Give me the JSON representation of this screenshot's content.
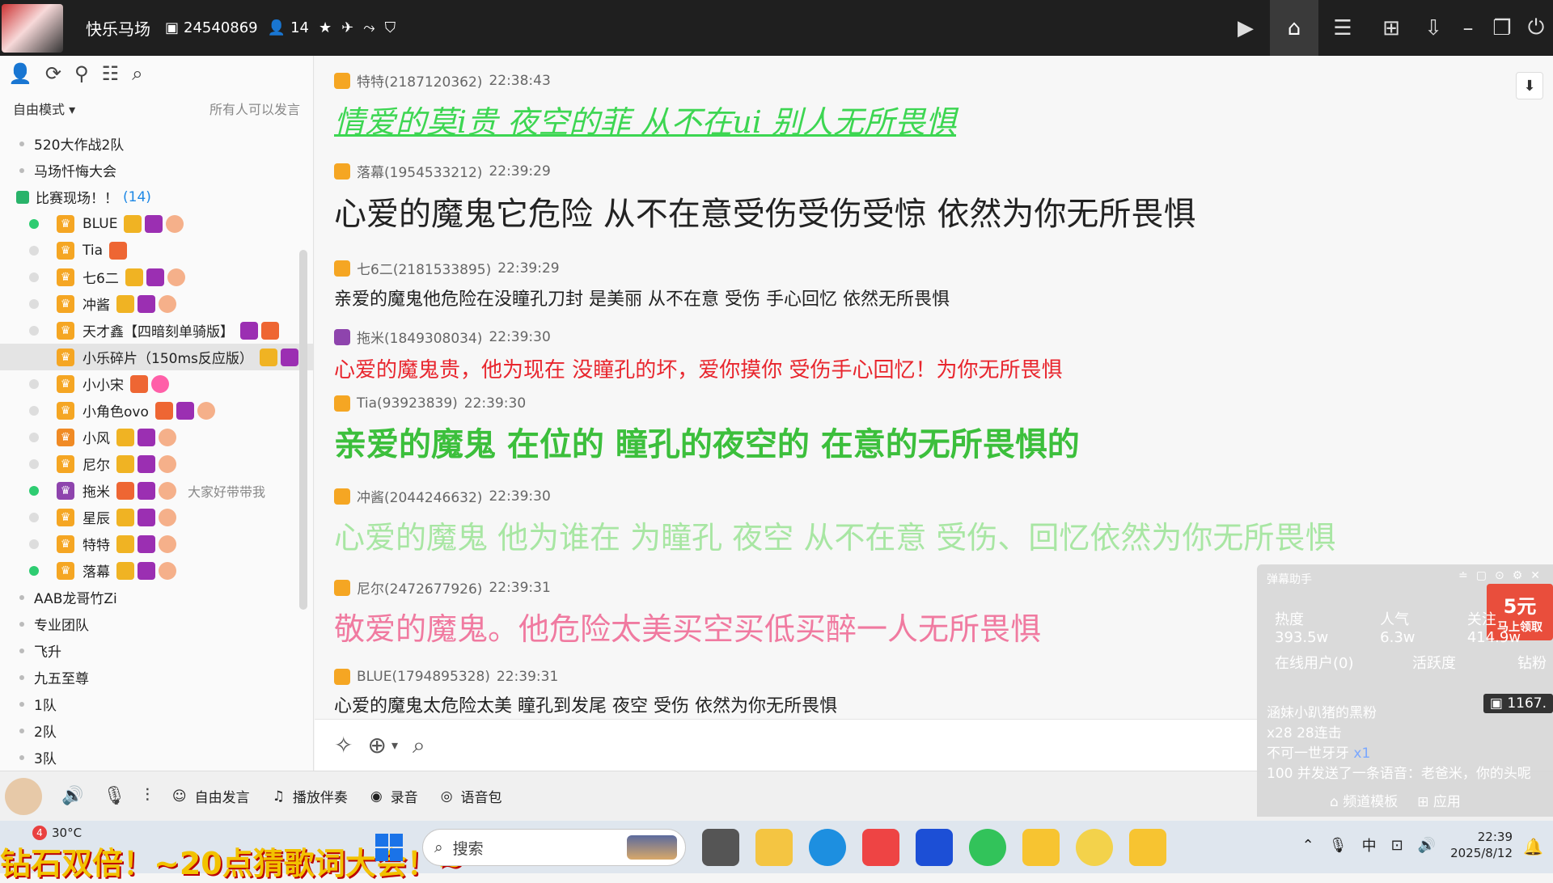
{
  "topbar": {
    "room_name": "快乐马场",
    "room_id": "24540869",
    "member_count": "14"
  },
  "sidebar": {
    "mode": "自由模式",
    "mode_note": "所有人可以发言",
    "groups_top": [
      "520大作战2队",
      "马场忏悔大会"
    ],
    "open_group": {
      "name": "比赛现场！！",
      "count": "(14)"
    },
    "members": [
      {
        "name": "BLUE",
        "online": true,
        "note": ""
      },
      {
        "name": "Tia",
        "online": false,
        "note": ""
      },
      {
        "name": "七6二",
        "online": false,
        "note": ""
      },
      {
        "name": "冲酱",
        "online": false,
        "note": ""
      },
      {
        "name": "天才鑫【四暗刻单骑版】",
        "online": false,
        "note": ""
      },
      {
        "name": "小乐碎片（150ms反应版）",
        "online": false,
        "note": "",
        "selected": true
      },
      {
        "name": "小小宋",
        "online": false,
        "note": ""
      },
      {
        "name": "小角色ovo",
        "online": false,
        "note": ""
      },
      {
        "name": "小风",
        "online": false,
        "note": ""
      },
      {
        "name": "尼尔",
        "online": false,
        "note": ""
      },
      {
        "name": "拖米",
        "online": true,
        "note": "大家好带带我"
      },
      {
        "name": "星辰",
        "online": false,
        "note": ""
      },
      {
        "name": "特特",
        "online": false,
        "note": ""
      },
      {
        "name": "落幕",
        "online": true,
        "note": ""
      }
    ],
    "groups_bottom": [
      "AAB龙哥竹Zi",
      "专业团队",
      "飞升",
      "九五至尊",
      "1队",
      "2队",
      "3队"
    ]
  },
  "chat": {
    "messages": [
      {
        "user": "特特(2187120362)",
        "time": "22:38:43",
        "text": "情爱的莫i贵   夜空的菲   从不在ui   别人无所畏惧",
        "color": "#3dd652",
        "size": 38,
        "italic": true,
        "underline": true
      },
      {
        "user": "落幕(1954533212)",
        "time": "22:39:29",
        "text": "心爱的魔鬼它危险  从不在意受伤受伤受惊  依然为你无所畏惧",
        "color": "#222222",
        "size": 40
      },
      {
        "user": "七6二(2181533895)",
        "time": "22:39:29",
        "text": "亲爱的魔鬼他危险在没瞳孔刀封  是美丽  从不在意  受伤  手心回忆  依然无所畏惧",
        "color": "#222222",
        "size": 22
      },
      {
        "user": "拖米(1849308034)",
        "time": "22:39:30",
        "text": "心爱的魔鬼贵，他为现在 没瞳孔的坏，爱你摸你 受伤手心回忆！为你无所畏惧",
        "color": "#e8262e",
        "size": 26
      },
      {
        "user": "Tia(93923839)",
        "time": "22:39:30",
        "text": "亲爱的魔鬼  在位的  瞳孔的夜空的  在意的无所畏惧的",
        "color": "#3cbf3c",
        "size": 40,
        "bold": true
      },
      {
        "user": "冲酱(2044246632)",
        "time": "22:39:30",
        "text": "心爱的魔鬼  他为谁在  为瞳孔  夜空  从不在意  受伤、回忆依然为你无所畏惧",
        "color": "#a8e6a3",
        "size": 38
      },
      {
        "user": "尼尔(2472677926)",
        "time": "22:39:31",
        "text": "敬爱的魔鬼。他危险太美买空买低买醉一人无所畏惧",
        "color": "#f07aa0",
        "size": 38
      },
      {
        "user": "BLUE(1794895328)",
        "time": "22:39:31",
        "text": "心爱的魔鬼太危险太美  瞳孔到发尾  夜空  受伤  依然为你无所畏惧",
        "color": "#222222",
        "size": 22
      }
    ]
  },
  "bottombar": {
    "free_speak": "自由发言",
    "play_bgm": "播放伴奏",
    "record": "录音",
    "voice_pack": "语音包"
  },
  "overlay": {
    "title": "弹幕助手",
    "promo_big": "5元",
    "promo_small": "马上领取",
    "heat": "热度 393.5w",
    "popularity": "人气 6.3w",
    "follow": "关注 414.9w",
    "online_users": "在线用户(0)",
    "activity": "活跃度",
    "diamond": "钻粉",
    "drill_value": "1167.",
    "feed_1a": "涵妹小趴猪的黑粉",
    "feed_1b": "x28 28连击",
    "feed_2a": "不可一世牙牙",
    "feed_2b": "x1",
    "feed_3": "100 并发送了一条语音：老爸米，你的头呢",
    "template": "频道模板",
    "apps": "应用"
  },
  "taskbar": {
    "badge": "4",
    "temp": "30°C",
    "ticker": "钻石双倍！~20点猜歌词大会！~",
    "search": "搜索",
    "ime": "中",
    "time": "22:39",
    "date": "2025/8/12"
  }
}
